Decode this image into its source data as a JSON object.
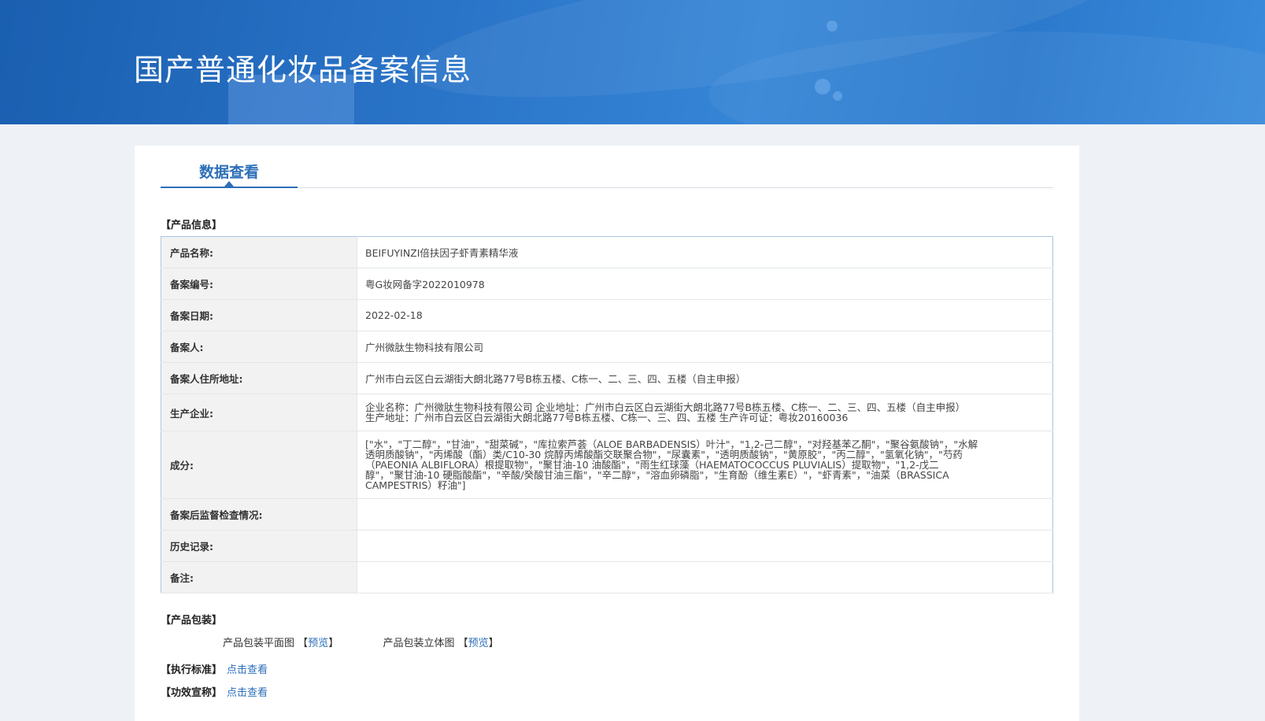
{
  "header": {
    "title": "国产普通化妆品备案信息"
  },
  "tabs": [
    {
      "label": "数据查看"
    }
  ],
  "sections": {
    "product_info": "【产品信息】",
    "packaging": "【产品包装】"
  },
  "product": {
    "rows": [
      {
        "label": "产品名称:",
        "value": "BEIFUYINZI倍扶因子虾青素精华液"
      },
      {
        "label": "备案编号:",
        "value": "粤G妆网备字2022010978"
      },
      {
        "label": "备案日期:",
        "value": "2022-02-18"
      },
      {
        "label": "备案人:",
        "value": "广州微肽生物科技有限公司"
      },
      {
        "label": "备案人住所地址:",
        "value": "广州市白云区白云湖街大朗北路77号B栋五楼、C栋一、二、三、四、五楼（自主申报）"
      },
      {
        "label": "生产企业:",
        "value_lines": [
          "企业名称：广州微肽生物科技有限公司 企业地址：广州市白云区白云湖街大朗北路77号B栋五楼、C栋一、二、三、四、五楼（自主申报）",
          "生产地址：广州市白云区白云湖街大朗北路77号B栋五楼、C栋一、三、四、五楼 生产许可证：粤妆20160036"
        ]
      },
      {
        "label": "成分:",
        "value_lines": [
          "[\"水\"，\"丁二醇\"，\"甘油\"，\"甜菜碱\"，\"库拉索芦荟（ALOE BARBADENSIS）叶汁\"，\"1,2-己二醇\"，\"对羟基苯乙酮\"，\"聚谷氨酸钠\"，\"水解",
          "透明质酸钠\"，\"丙烯酸（酯）类/C10-30 烷醇丙烯酸酯交联聚合物\"，\"尿囊素\"，\"透明质酸钠\"，\"黄原胶\"，\"丙二醇\"，\"氢氧化钠\"，\"芍药",
          "（PAEONIA ALBIFLORA）根提取物\"，\"聚甘油-10 油酸酯\"，\"雨生红球藻（HAEMATOCOCCUS PLUVIALIS）提取物\"，\"1,2-戊二",
          "醇\"，\"聚甘油-10 硬脂酸酯\"，\"辛酸/癸酸甘油三酯\"，\"辛二醇\"，\"溶血卵磷脂\"，\"生育酚（维生素E）\"，\"虾青素\"，\"油菜（BRASSICA",
          "CAMPESTRIS）籽油\"]"
        ]
      },
      {
        "label": "备案后监督检查情况:",
        "value": ""
      },
      {
        "label": "历史记录:",
        "value": ""
      },
      {
        "label": "备注:",
        "value": ""
      }
    ]
  },
  "packaging": {
    "flat_label": "产品包装平面图",
    "solid_label": "产品包装立体图",
    "bracket_open": "【",
    "bracket_close": "】",
    "preview": "预览"
  },
  "standards": {
    "label": "【执行标准】",
    "link": "点击查看"
  },
  "efficacy": {
    "label": "【功效宣称】",
    "link": "点击查看"
  },
  "colors": {
    "banner": "#2a74c8",
    "accent": "#2d6fb8",
    "page_bg": "#eef2f6"
  }
}
